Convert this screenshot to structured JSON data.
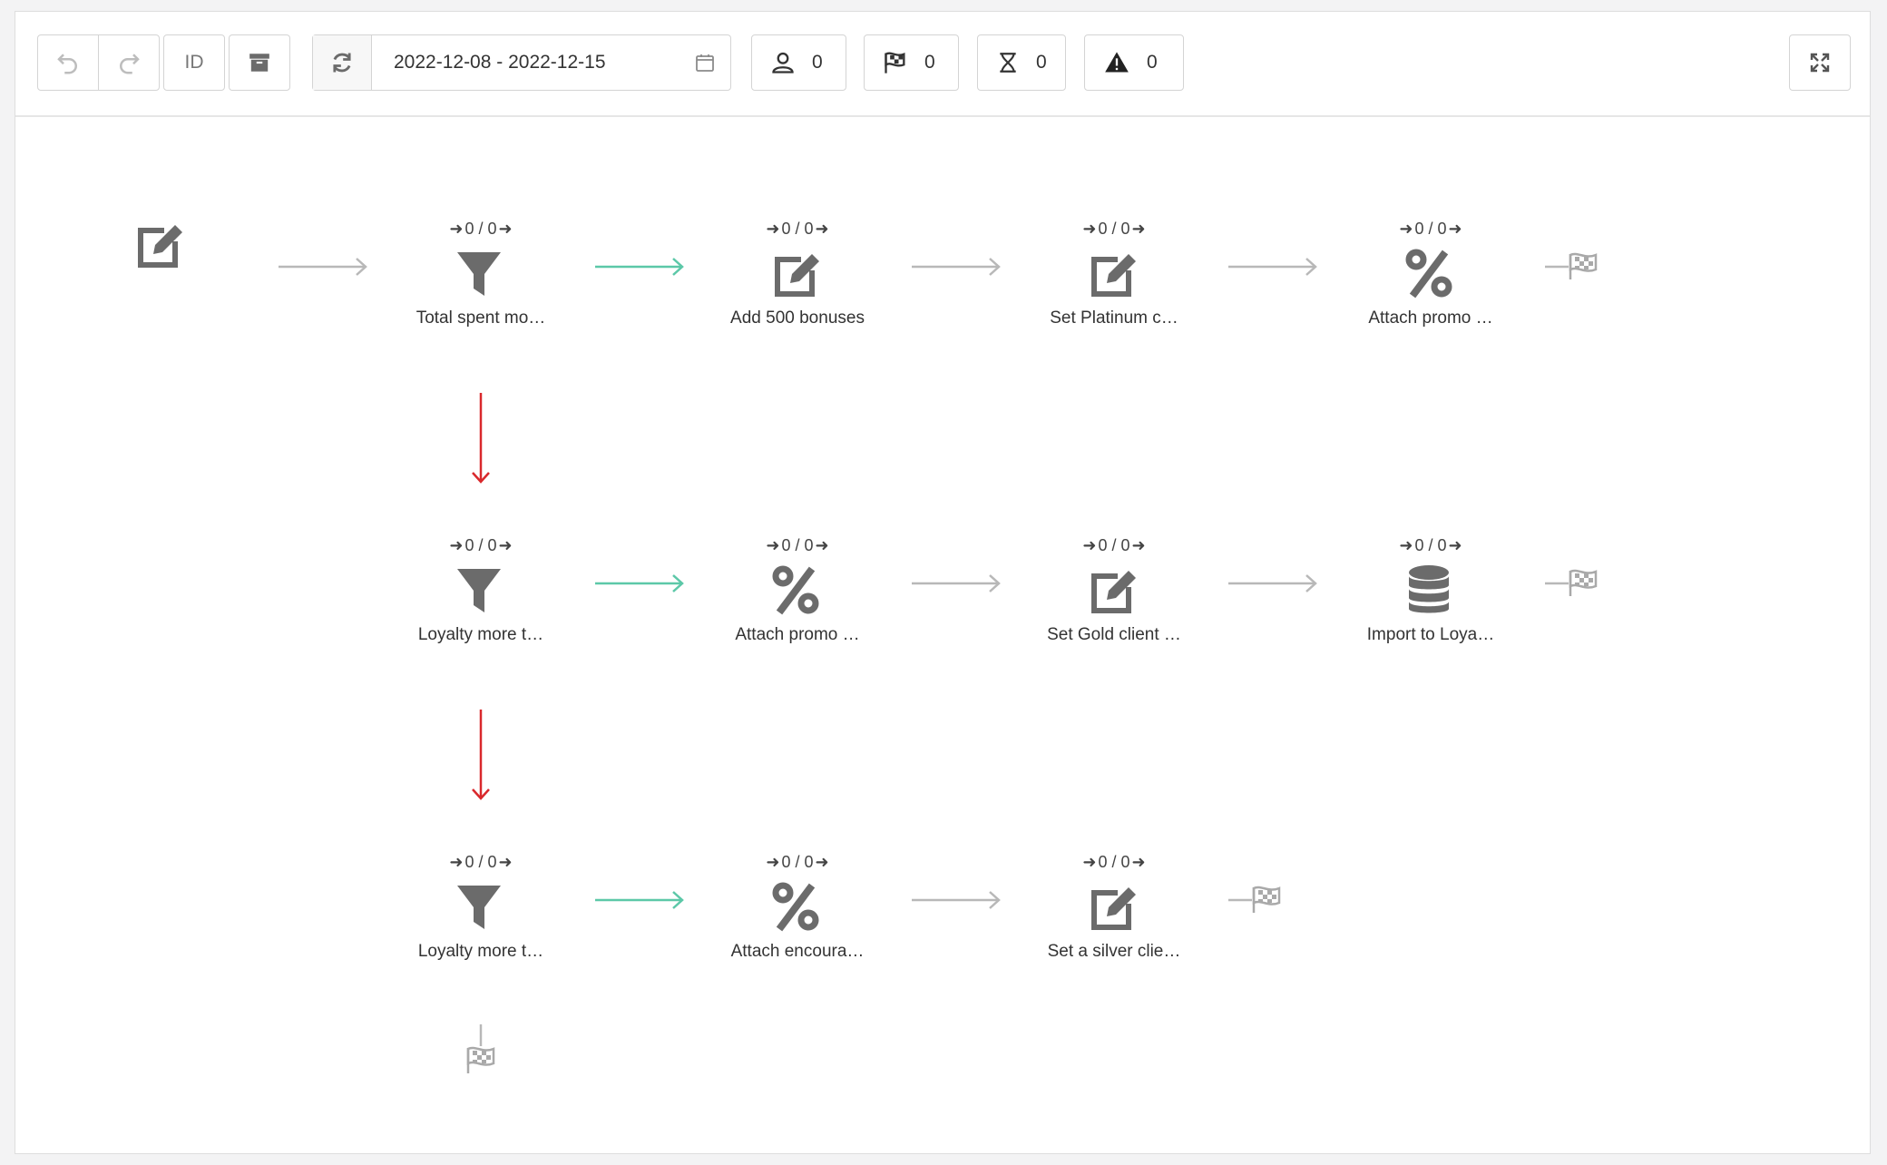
{
  "toolbar": {
    "id_label": "ID",
    "date_range": "2022-12-08 - 2022-12-15",
    "stats": {
      "users": "0",
      "finished": "0",
      "waiting": "0",
      "errors": "0"
    }
  },
  "workflow": {
    "nodes": [
      {
        "counter": "0 / 0",
        "label": "Total spent mo…",
        "icon": "filter-icon"
      },
      {
        "counter": "0 / 0",
        "label": "Add 500 bonuses",
        "icon": "edit-icon"
      },
      {
        "counter": "0 / 0",
        "label": "Set Platinum c…",
        "icon": "edit-icon"
      },
      {
        "counter": "0 / 0",
        "label": "Attach promo …",
        "icon": "percent-icon"
      },
      {
        "counter": "0 / 0",
        "label": "Loyalty more t…",
        "icon": "filter-icon"
      },
      {
        "counter": "0 / 0",
        "label": "Attach promo …",
        "icon": "percent-icon"
      },
      {
        "counter": "0 / 0",
        "label": "Set Gold client …",
        "icon": "edit-icon"
      },
      {
        "counter": "0 / 0",
        "label": "Import to Loya…",
        "icon": "database-icon"
      },
      {
        "counter": "0 / 0",
        "label": "Loyalty more t…",
        "icon": "filter-icon"
      },
      {
        "counter": "0 / 0",
        "label": "Attach encoura…",
        "icon": "percent-icon"
      },
      {
        "counter": "0 / 0",
        "label": "Set a silver clie…",
        "icon": "edit-icon"
      }
    ]
  },
  "colors": {
    "icon": "#6b6b6b",
    "edge_default": "#b8b8b8",
    "edge_yes": "#5cc8a8",
    "edge_no": "#d9282c",
    "finish": "#a9a9a9"
  }
}
